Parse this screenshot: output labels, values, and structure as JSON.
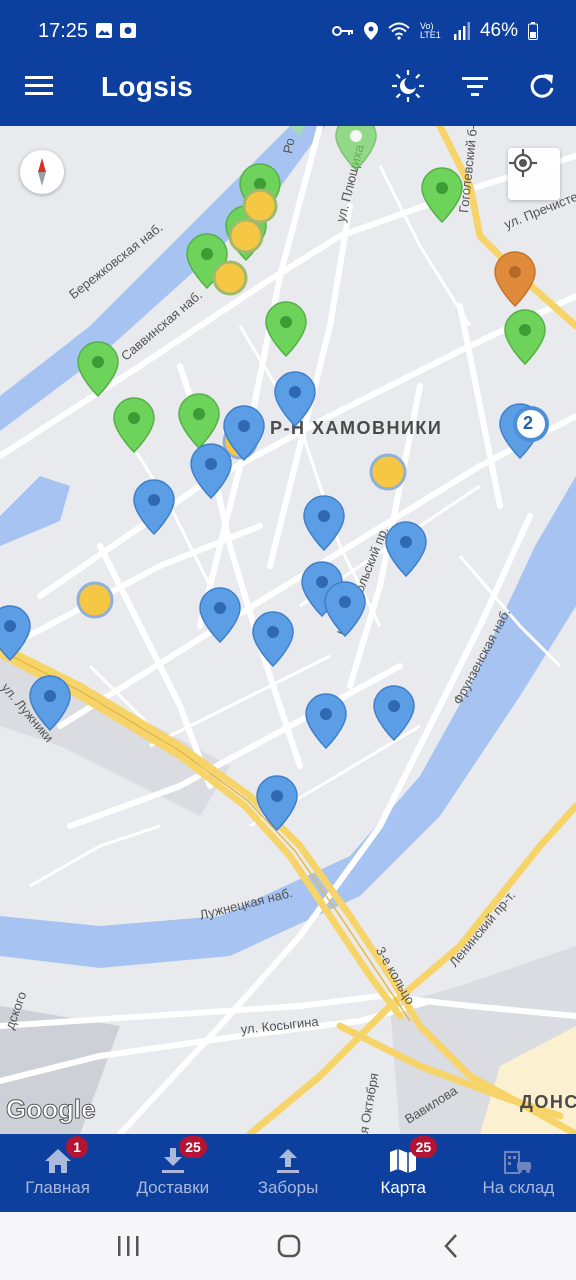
{
  "status_bar": {
    "time": "17:25",
    "battery": "46%",
    "network": "Vo) LTE1"
  },
  "app_bar": {
    "title": "Logsis"
  },
  "map": {
    "labels": {
      "district": "Р-Н ХАМОВНИКИ",
      "berezhkovskaya": "Бережковская наб.",
      "savvinskaya": "Саввинская наб.",
      "plyushchikha": "ул. Плющиха",
      "komsomolsky": "Комсомольский пр.",
      "frunzenskaya": "Фрунзенская наб.",
      "luzhniki_st": "ул. Лужники",
      "luzhnetskaya": "Лужнецкая наб.",
      "leninsky": "Ленинский пр-т.",
      "ring3": "3-е кольцо",
      "kosygina": "ул. Косыгина",
      "oktyabrya": "я Октября",
      "vavilova": "Вавилова",
      "prechistenka": "ул. Пречистенка",
      "gogolevsky": "Гоголевский б-р",
      "don": "ДОНС",
      "ro": "Ро",
      "dskogo": "дского"
    },
    "cluster_count": "2",
    "attribution": "Google",
    "marker_colors": {
      "green": "#6dd35b",
      "yellow": "#f5c742",
      "blue": "#5b9ee6",
      "orange": "#e08b3c"
    }
  },
  "bottom_nav": [
    {
      "label": "Главная",
      "badge": "1",
      "icon": "home-icon",
      "active": false
    },
    {
      "label": "Доставки",
      "badge": "25",
      "icon": "download-icon",
      "active": false
    },
    {
      "label": "Заборы",
      "badge": "",
      "icon": "upload-icon",
      "active": false
    },
    {
      "label": "Карта",
      "badge": "25",
      "icon": "map-icon",
      "active": true
    },
    {
      "label": "На склад",
      "badge": "",
      "icon": "warehouse-icon",
      "active": false
    }
  ],
  "colors": {
    "primary": "#0d3f9e",
    "badge": "#b41333",
    "water": "#a6c3f2",
    "major_road": "#f7d46a"
  }
}
